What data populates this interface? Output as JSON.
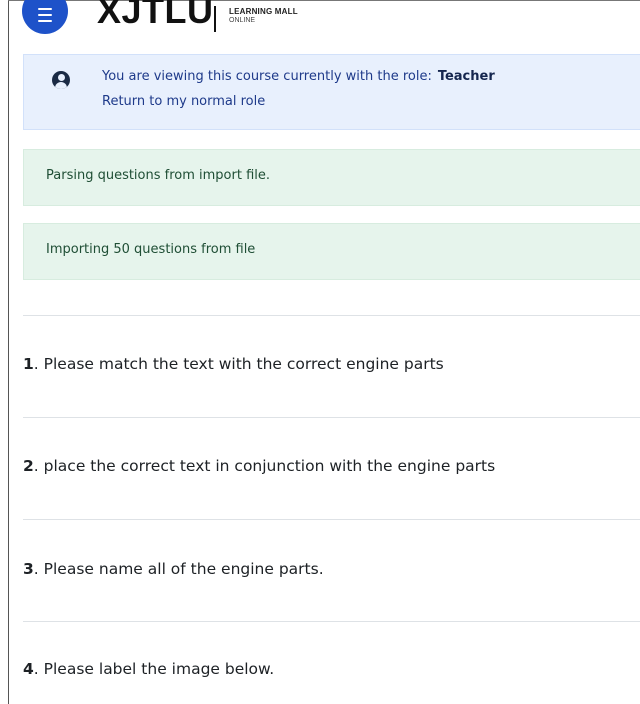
{
  "header": {
    "brand": "XJTLU",
    "subtitle_line1": "LEARNING MALL",
    "subtitle_line2": "ONLINE"
  },
  "role_notice": {
    "text": "You are viewing this course currently with the role:",
    "role": "Teacher",
    "return_link": "Return to my normal role"
  },
  "notices": [
    "Parsing questions from import file.",
    "Importing 50 questions from file"
  ],
  "questions": [
    {
      "number": "1",
      "text": "Please match the text with the correct engine parts"
    },
    {
      "number": "2",
      "text": "place the correct text in conjunction with the engine parts"
    },
    {
      "number": "3",
      "text": "Please name all of the engine parts."
    },
    {
      "number": "4",
      "text": "Please label the image below."
    }
  ],
  "colors": {
    "brand_blue": "#1e52c9",
    "info_bg": "#e8f0fd",
    "success_bg": "#e6f4ec"
  },
  "icons": [
    "menu-icon",
    "user-circle-icon"
  ]
}
